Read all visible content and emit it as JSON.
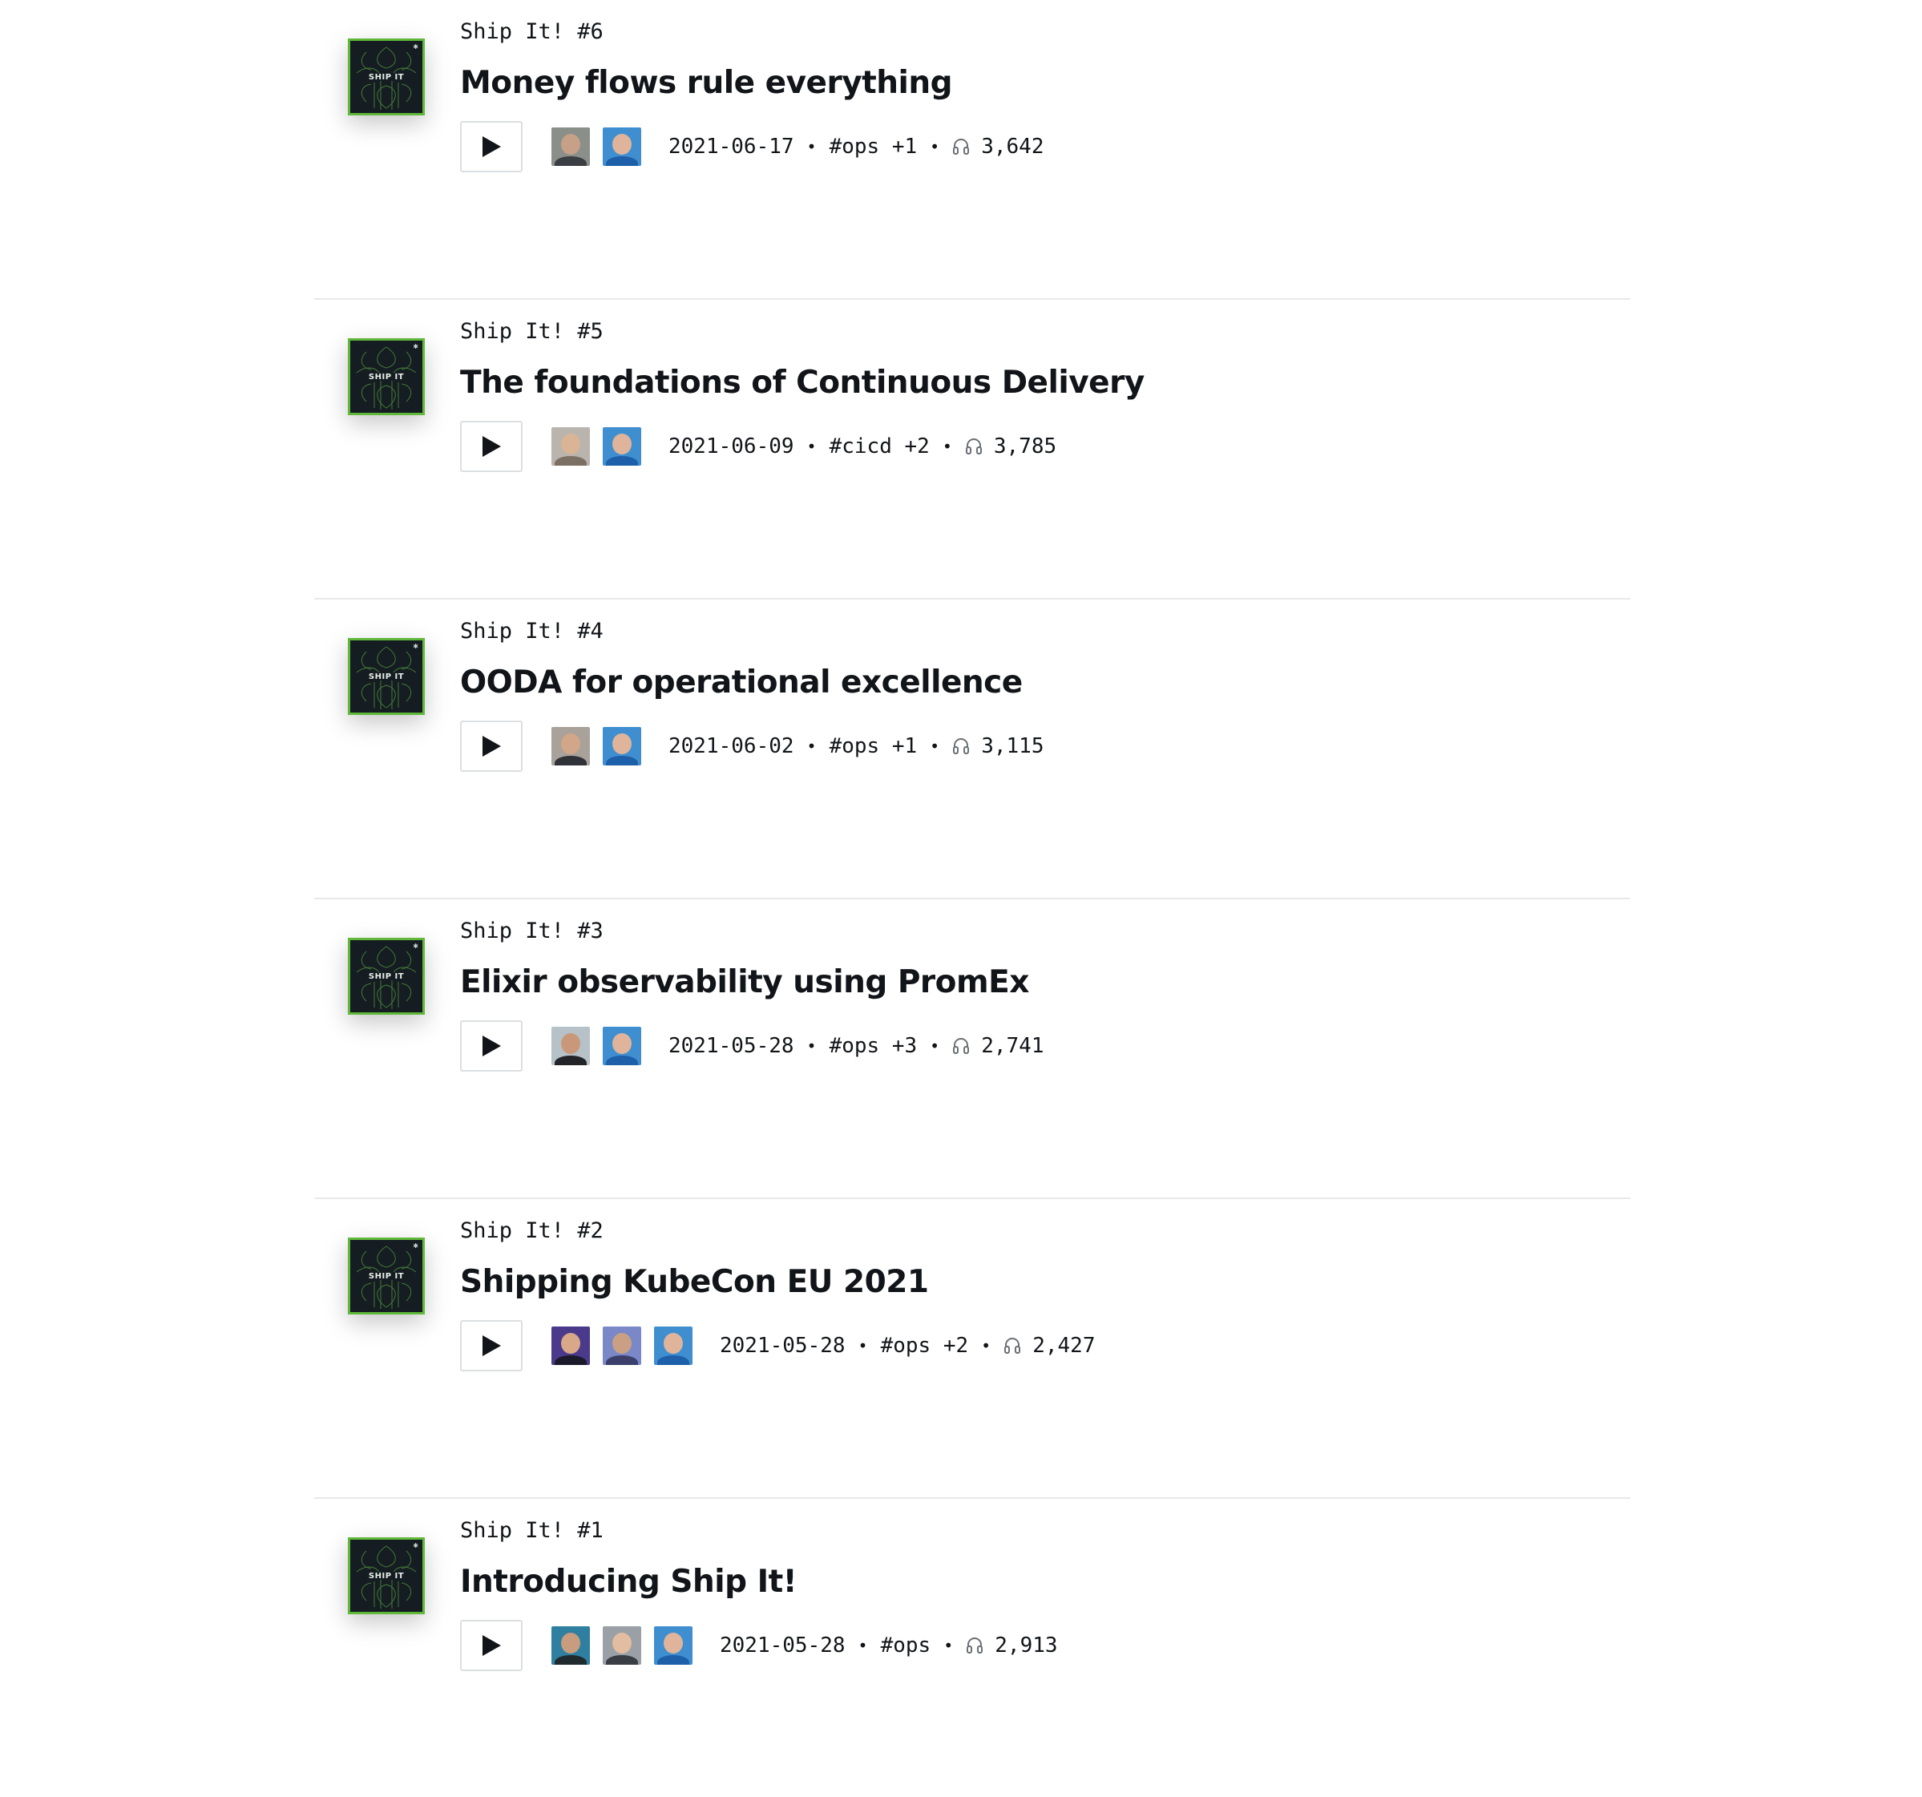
{
  "episodes": [
    {
      "podcast": "Ship It! #6",
      "title": "Money flows rule everything",
      "date": "2021-06-17",
      "tags": "#ops +1",
      "listens": "3,642",
      "artwork_label": "SHIP IT",
      "avatars": [
        {
          "bg": "#8a8f8a",
          "face": "#c7a088",
          "body": "#3b3e42"
        },
        {
          "bg": "#3f8fd0",
          "face": "#e0b49a",
          "body": "#1d5fa8"
        }
      ]
    },
    {
      "podcast": "Ship It! #5",
      "title": "The foundations of Continuous Delivery",
      "date": "2021-06-09",
      "tags": "#cicd +2",
      "listens": "3,785",
      "artwork_label": "SHIP IT",
      "avatars": [
        {
          "bg": "#b9b4ad",
          "face": "#d9b596",
          "body": "#7c6f63"
        },
        {
          "bg": "#3f8fd0",
          "face": "#e0b49a",
          "body": "#1d5fa8"
        }
      ]
    },
    {
      "podcast": "Ship It! #4",
      "title": "OODA for operational excellence",
      "date": "2021-06-02",
      "tags": "#ops +1",
      "listens": "3,115",
      "artwork_label": "SHIP IT",
      "avatars": [
        {
          "bg": "#a8a29a",
          "face": "#d2a688",
          "body": "#2f3237"
        },
        {
          "bg": "#3f8fd0",
          "face": "#e0b49a",
          "body": "#1d5fa8"
        }
      ]
    },
    {
      "podcast": "Ship It! #3",
      "title": "Elixir observability using PromEx",
      "date": "2021-05-28",
      "tags": "#ops +3",
      "listens": "2,741",
      "artwork_label": "SHIP IT",
      "avatars": [
        {
          "bg": "#b6c2c7",
          "face": "#c9987a",
          "body": "#222428"
        },
        {
          "bg": "#3f8fd0",
          "face": "#e0b49a",
          "body": "#1d5fa8"
        }
      ]
    },
    {
      "podcast": "Ship It! #2",
      "title": "Shipping KubeCon EU 2021",
      "date": "2021-05-28",
      "tags": "#ops +2",
      "listens": "2,427",
      "artwork_label": "SHIP IT",
      "avatars": [
        {
          "bg": "#4b3a8c",
          "face": "#d8a888",
          "body": "#1a1a2a"
        },
        {
          "bg": "#7a88c8",
          "face": "#caa084",
          "body": "#3b3f6a"
        },
        {
          "bg": "#3f8fd0",
          "face": "#e0b49a",
          "body": "#1d5fa8"
        }
      ]
    },
    {
      "podcast": "Ship It! #1",
      "title": "Introducing Ship It!",
      "date": "2021-05-28",
      "tags": "#ops",
      "listens": "2,913",
      "artwork_label": "SHIP IT",
      "avatars": [
        {
          "bg": "#2f7fa0",
          "face": "#c89c7e",
          "body": "#1f2a2f"
        },
        {
          "bg": "#9aa0a6",
          "face": "#e2bda2",
          "body": "#3a3e44"
        },
        {
          "bg": "#3f8fd0",
          "face": "#e0b49a",
          "body": "#1d5fa8"
        }
      ]
    }
  ],
  "colors": {
    "artwork_bg": "#151d22",
    "artwork_border": "#5fb83a",
    "divider": "#e6e8ea",
    "text": "#111418"
  },
  "icons": {
    "play": "play-icon",
    "listens": "headphones-icon"
  }
}
